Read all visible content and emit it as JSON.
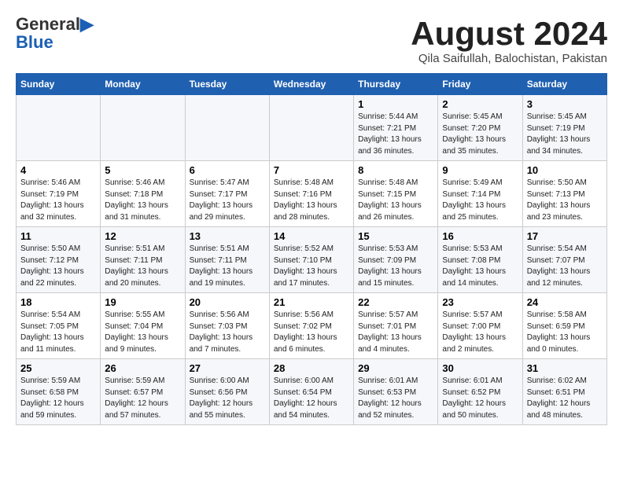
{
  "logo": {
    "line1": "General",
    "line2": "Blue"
  },
  "title": "August 2024",
  "subtitle": "Qila Saifullah, Balochistan, Pakistan",
  "days_of_week": [
    "Sunday",
    "Monday",
    "Tuesday",
    "Wednesday",
    "Thursday",
    "Friday",
    "Saturday"
  ],
  "weeks": [
    [
      {
        "num": "",
        "text": ""
      },
      {
        "num": "",
        "text": ""
      },
      {
        "num": "",
        "text": ""
      },
      {
        "num": "",
        "text": ""
      },
      {
        "num": "1",
        "text": "Sunrise: 5:44 AM\nSunset: 7:21 PM\nDaylight: 13 hours\nand 36 minutes."
      },
      {
        "num": "2",
        "text": "Sunrise: 5:45 AM\nSunset: 7:20 PM\nDaylight: 13 hours\nand 35 minutes."
      },
      {
        "num": "3",
        "text": "Sunrise: 5:45 AM\nSunset: 7:19 PM\nDaylight: 13 hours\nand 34 minutes."
      }
    ],
    [
      {
        "num": "4",
        "text": "Sunrise: 5:46 AM\nSunset: 7:19 PM\nDaylight: 13 hours\nand 32 minutes."
      },
      {
        "num": "5",
        "text": "Sunrise: 5:46 AM\nSunset: 7:18 PM\nDaylight: 13 hours\nand 31 minutes."
      },
      {
        "num": "6",
        "text": "Sunrise: 5:47 AM\nSunset: 7:17 PM\nDaylight: 13 hours\nand 29 minutes."
      },
      {
        "num": "7",
        "text": "Sunrise: 5:48 AM\nSunset: 7:16 PM\nDaylight: 13 hours\nand 28 minutes."
      },
      {
        "num": "8",
        "text": "Sunrise: 5:48 AM\nSunset: 7:15 PM\nDaylight: 13 hours\nand 26 minutes."
      },
      {
        "num": "9",
        "text": "Sunrise: 5:49 AM\nSunset: 7:14 PM\nDaylight: 13 hours\nand 25 minutes."
      },
      {
        "num": "10",
        "text": "Sunrise: 5:50 AM\nSunset: 7:13 PM\nDaylight: 13 hours\nand 23 minutes."
      }
    ],
    [
      {
        "num": "11",
        "text": "Sunrise: 5:50 AM\nSunset: 7:12 PM\nDaylight: 13 hours\nand 22 minutes."
      },
      {
        "num": "12",
        "text": "Sunrise: 5:51 AM\nSunset: 7:11 PM\nDaylight: 13 hours\nand 20 minutes."
      },
      {
        "num": "13",
        "text": "Sunrise: 5:51 AM\nSunset: 7:11 PM\nDaylight: 13 hours\nand 19 minutes."
      },
      {
        "num": "14",
        "text": "Sunrise: 5:52 AM\nSunset: 7:10 PM\nDaylight: 13 hours\nand 17 minutes."
      },
      {
        "num": "15",
        "text": "Sunrise: 5:53 AM\nSunset: 7:09 PM\nDaylight: 13 hours\nand 15 minutes."
      },
      {
        "num": "16",
        "text": "Sunrise: 5:53 AM\nSunset: 7:08 PM\nDaylight: 13 hours\nand 14 minutes."
      },
      {
        "num": "17",
        "text": "Sunrise: 5:54 AM\nSunset: 7:07 PM\nDaylight: 13 hours\nand 12 minutes."
      }
    ],
    [
      {
        "num": "18",
        "text": "Sunrise: 5:54 AM\nSunset: 7:05 PM\nDaylight: 13 hours\nand 11 minutes."
      },
      {
        "num": "19",
        "text": "Sunrise: 5:55 AM\nSunset: 7:04 PM\nDaylight: 13 hours\nand 9 minutes."
      },
      {
        "num": "20",
        "text": "Sunrise: 5:56 AM\nSunset: 7:03 PM\nDaylight: 13 hours\nand 7 minutes."
      },
      {
        "num": "21",
        "text": "Sunrise: 5:56 AM\nSunset: 7:02 PM\nDaylight: 13 hours\nand 6 minutes."
      },
      {
        "num": "22",
        "text": "Sunrise: 5:57 AM\nSunset: 7:01 PM\nDaylight: 13 hours\nand 4 minutes."
      },
      {
        "num": "23",
        "text": "Sunrise: 5:57 AM\nSunset: 7:00 PM\nDaylight: 13 hours\nand 2 minutes."
      },
      {
        "num": "24",
        "text": "Sunrise: 5:58 AM\nSunset: 6:59 PM\nDaylight: 13 hours\nand 0 minutes."
      }
    ],
    [
      {
        "num": "25",
        "text": "Sunrise: 5:59 AM\nSunset: 6:58 PM\nDaylight: 12 hours\nand 59 minutes."
      },
      {
        "num": "26",
        "text": "Sunrise: 5:59 AM\nSunset: 6:57 PM\nDaylight: 12 hours\nand 57 minutes."
      },
      {
        "num": "27",
        "text": "Sunrise: 6:00 AM\nSunset: 6:56 PM\nDaylight: 12 hours\nand 55 minutes."
      },
      {
        "num": "28",
        "text": "Sunrise: 6:00 AM\nSunset: 6:54 PM\nDaylight: 12 hours\nand 54 minutes."
      },
      {
        "num": "29",
        "text": "Sunrise: 6:01 AM\nSunset: 6:53 PM\nDaylight: 12 hours\nand 52 minutes."
      },
      {
        "num": "30",
        "text": "Sunrise: 6:01 AM\nSunset: 6:52 PM\nDaylight: 12 hours\nand 50 minutes."
      },
      {
        "num": "31",
        "text": "Sunrise: 6:02 AM\nSunset: 6:51 PM\nDaylight: 12 hours\nand 48 minutes."
      }
    ]
  ]
}
